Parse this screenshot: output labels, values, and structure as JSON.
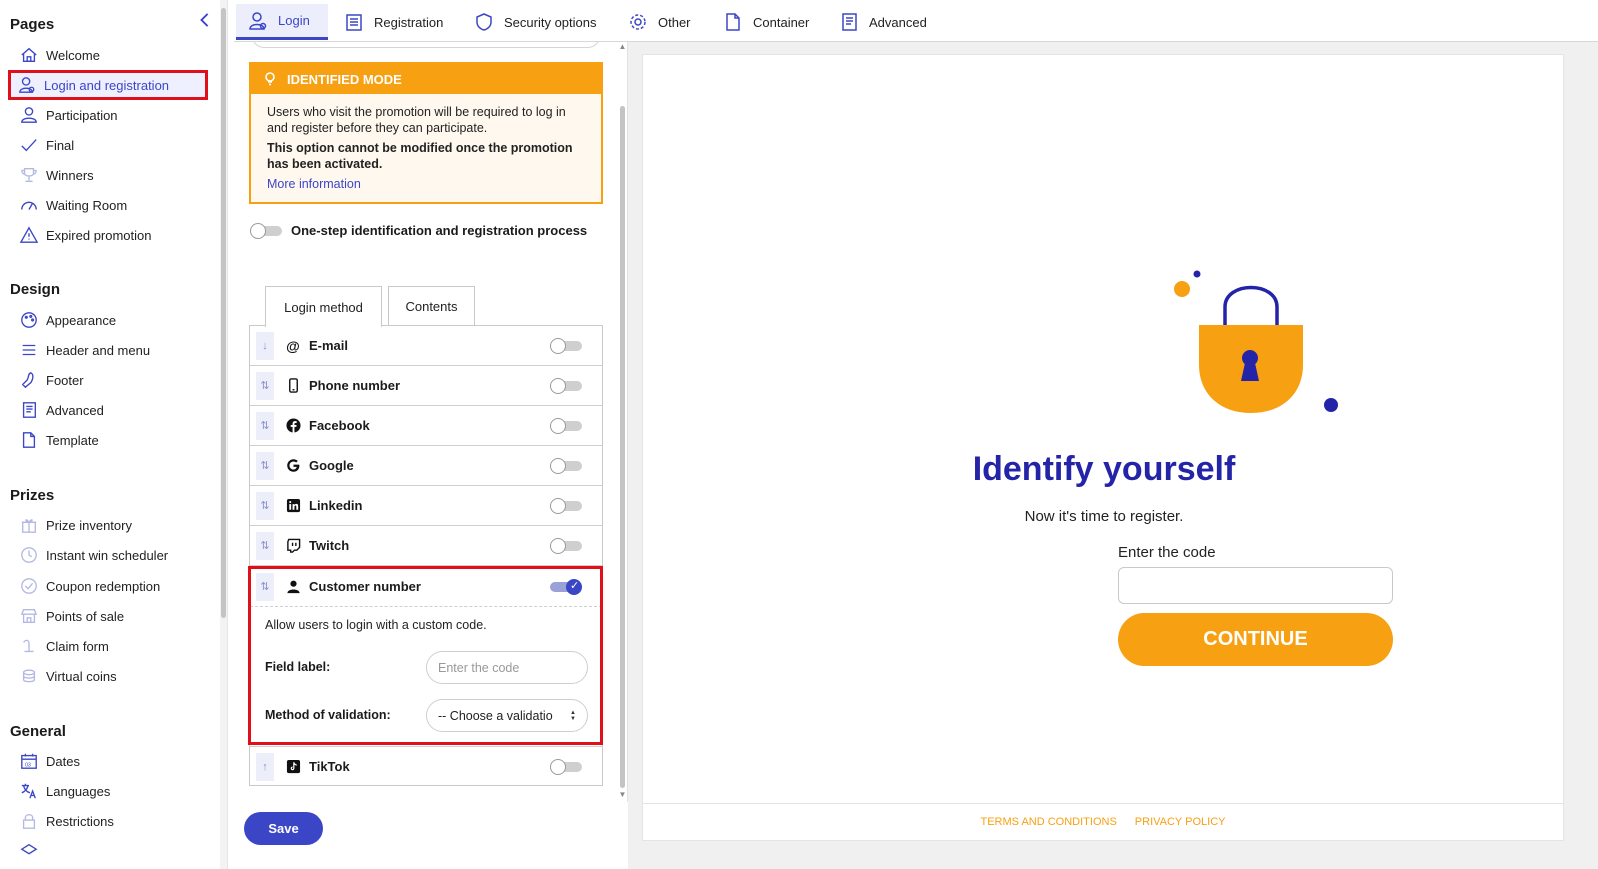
{
  "sidebar": {
    "sections": {
      "pages": "Pages",
      "design": "Design",
      "prizes": "Prizes",
      "general": "General"
    },
    "pages_items": [
      {
        "label": "Welcome",
        "icon": "home-icon"
      },
      {
        "label": "Login and registration",
        "icon": "user-settings-icon"
      },
      {
        "label": "Participation",
        "icon": "user-icon"
      },
      {
        "label": "Final",
        "icon": "check-icon"
      },
      {
        "label": "Winners",
        "icon": "trophy-icon"
      },
      {
        "label": "Waiting Room",
        "icon": "gauge-icon"
      },
      {
        "label": "Expired promotion",
        "icon": "warning-icon"
      }
    ],
    "design_items": [
      {
        "label": "Appearance",
        "icon": "palette-icon"
      },
      {
        "label": "Header and menu",
        "icon": "menu-icon"
      },
      {
        "label": "Footer",
        "icon": "foot-icon"
      },
      {
        "label": "Advanced",
        "icon": "code-doc-icon"
      },
      {
        "label": "Template",
        "icon": "file-icon"
      }
    ],
    "prizes_items": [
      {
        "label": "Prize inventory",
        "icon": "gift-icon"
      },
      {
        "label": "Instant win scheduler",
        "icon": "clock-icon"
      },
      {
        "label": "Coupon redemption",
        "icon": "coupon-icon"
      },
      {
        "label": "Points of sale",
        "icon": "store-icon"
      },
      {
        "label": "Claim form",
        "icon": "form-icon"
      },
      {
        "label": "Virtual coins",
        "icon": "coins-icon"
      }
    ],
    "general_items": [
      {
        "label": "Dates",
        "icon": "calendar-icon",
        "badge": "03"
      },
      {
        "label": "Languages",
        "icon": "translate-icon"
      },
      {
        "label": "Restrictions",
        "icon": "lock-icon"
      }
    ]
  },
  "top_tabs": [
    {
      "label": "Login",
      "icon": "user-icon"
    },
    {
      "label": "Registration",
      "icon": "form-icon"
    },
    {
      "label": "Security options",
      "icon": "shield-icon"
    },
    {
      "label": "Other",
      "icon": "gear-icon"
    },
    {
      "label": "Container",
      "icon": "file-icon"
    },
    {
      "label": "Advanced",
      "icon": "code-doc-icon"
    }
  ],
  "alert": {
    "title": "IDENTIFIED MODE",
    "text": "Users who visit the promotion will be required to log in and register before they can participate.",
    "strong": "This option cannot be modified once the promotion has been activated.",
    "link": "More information"
  },
  "onestep_label": "One-step identification and registration process",
  "panel_tabs": [
    "Login method",
    "Contents"
  ],
  "methods": [
    {
      "label": "E-mail",
      "icon": "at-icon",
      "drag": "↓",
      "enabled": false
    },
    {
      "label": "Phone number",
      "icon": "phone-icon",
      "drag": "⇅",
      "enabled": false
    },
    {
      "label": "Facebook",
      "icon": "facebook-icon",
      "drag": "⇅",
      "enabled": false
    },
    {
      "label": "Google",
      "icon": "google-icon",
      "drag": "⇅",
      "enabled": false
    },
    {
      "label": "Linkedin",
      "icon": "linkedin-icon",
      "drag": "⇅",
      "enabled": false
    },
    {
      "label": "Twitch",
      "icon": "twitch-icon",
      "drag": "⇅",
      "enabled": false
    },
    {
      "label": "Customer number",
      "icon": "person-icon",
      "drag": "⇅",
      "enabled": true
    },
    {
      "label": "TikTok",
      "icon": "tiktok-icon",
      "drag": "↑",
      "enabled": false
    }
  ],
  "customer_number": {
    "description": "Allow users to login with a custom code.",
    "field_label": "Field label:",
    "field_placeholder": "Enter the code",
    "validation_label": "Method of validation:",
    "validation_value": "-- Choose a validatio"
  },
  "save_label": "Save",
  "preview": {
    "title": "Identify yourself",
    "subtitle": "Now it's time to register.",
    "input_label": "Enter the code",
    "button": "CONTINUE",
    "footer_links": [
      "TERMS AND CONDITIONS",
      "PRIVACY POLICY"
    ],
    "colors": {
      "primary": "#2424a8",
      "accent": "#f7a012"
    }
  }
}
